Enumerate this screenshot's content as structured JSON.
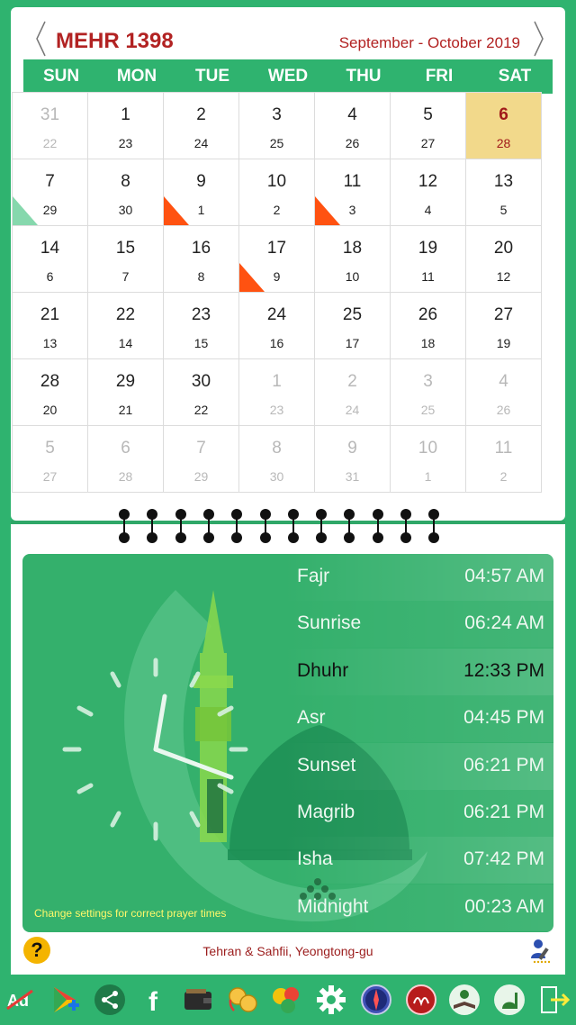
{
  "header": {
    "title": "MEHR 1398",
    "range": "September - October 2019"
  },
  "weekdays": [
    "SUN",
    "MON",
    "TUE",
    "WED",
    "THU",
    "FRI",
    "SAT"
  ],
  "weeks": [
    [
      {
        "p": "31",
        "s": "22",
        "muted": true
      },
      {
        "p": "1",
        "s": "23"
      },
      {
        "p": "2",
        "s": "24"
      },
      {
        "p": "3",
        "s": "25"
      },
      {
        "p": "4",
        "s": "26"
      },
      {
        "p": "5",
        "s": "27"
      },
      {
        "p": "6",
        "s": "28",
        "today": true
      }
    ],
    [
      {
        "p": "7",
        "s": "29",
        "corner": "green"
      },
      {
        "p": "8",
        "s": "30"
      },
      {
        "p": "9",
        "s": "1",
        "corner": "red"
      },
      {
        "p": "10",
        "s": "2"
      },
      {
        "p": "11",
        "s": "3",
        "corner": "red"
      },
      {
        "p": "12",
        "s": "4"
      },
      {
        "p": "13",
        "s": "5"
      }
    ],
    [
      {
        "p": "14",
        "s": "6"
      },
      {
        "p": "15",
        "s": "7"
      },
      {
        "p": "16",
        "s": "8"
      },
      {
        "p": "17",
        "s": "9",
        "corner": "red"
      },
      {
        "p": "18",
        "s": "10"
      },
      {
        "p": "19",
        "s": "11"
      },
      {
        "p": "20",
        "s": "12"
      }
    ],
    [
      {
        "p": "21",
        "s": "13"
      },
      {
        "p": "22",
        "s": "14"
      },
      {
        "p": "23",
        "s": "15"
      },
      {
        "p": "24",
        "s": "16"
      },
      {
        "p": "25",
        "s": "17"
      },
      {
        "p": "26",
        "s": "18"
      },
      {
        "p": "27",
        "s": "19"
      }
    ],
    [
      {
        "p": "28",
        "s": "20"
      },
      {
        "p": "29",
        "s": "21"
      },
      {
        "p": "30",
        "s": "22"
      },
      {
        "p": "1",
        "s": "23",
        "muted": true
      },
      {
        "p": "2",
        "s": "24",
        "muted": true
      },
      {
        "p": "3",
        "s": "25",
        "muted": true
      },
      {
        "p": "4",
        "s": "26",
        "muted": true
      }
    ],
    [
      {
        "p": "5",
        "s": "27",
        "muted": true
      },
      {
        "p": "6",
        "s": "28",
        "muted": true
      },
      {
        "p": "7",
        "s": "29",
        "muted": true
      },
      {
        "p": "8",
        "s": "30",
        "muted": true
      },
      {
        "p": "9",
        "s": "31",
        "muted": true
      },
      {
        "p": "10",
        "s": "1",
        "muted": true
      },
      {
        "p": "11",
        "s": "2",
        "muted": true
      }
    ]
  ],
  "prayers": [
    {
      "name": "Fajr",
      "time": "04:57 AM"
    },
    {
      "name": "Sunrise",
      "time": "06:24 AM"
    },
    {
      "name": "Dhuhr",
      "time": "12:33 PM",
      "current": true
    },
    {
      "name": "Asr",
      "time": "04:45 PM"
    },
    {
      "name": "Sunset",
      "time": "06:21 PM"
    },
    {
      "name": "Magrib",
      "time": "06:21 PM"
    },
    {
      "name": "Isha",
      "time": "07:42 PM"
    },
    {
      "name": "Midnight",
      "time": "00:23 AM"
    }
  ],
  "settings_hint": "Change settings for correct prayer times",
  "footer": {
    "help_label": "?",
    "location": "Tehran & Sahfii, Yeongtong-gu"
  },
  "toolbar_icons": [
    "ad-free-icon",
    "google-play-plus-icon",
    "share-icon",
    "facebook-icon",
    "wallet-icon",
    "currency-exchange-icon",
    "chat-bubbles-icon",
    "settings-gear-icon",
    "compass-icon",
    "allah-calligraphy-icon",
    "quran-reader-icon",
    "mosque-icon",
    "exit-icon"
  ],
  "colors": {
    "brand_green": "#2fb36f",
    "title_red": "#b22222",
    "today_bg": "#f2d98b",
    "event_marker": "#ff5211",
    "hint_yellow": "#fff86a"
  }
}
